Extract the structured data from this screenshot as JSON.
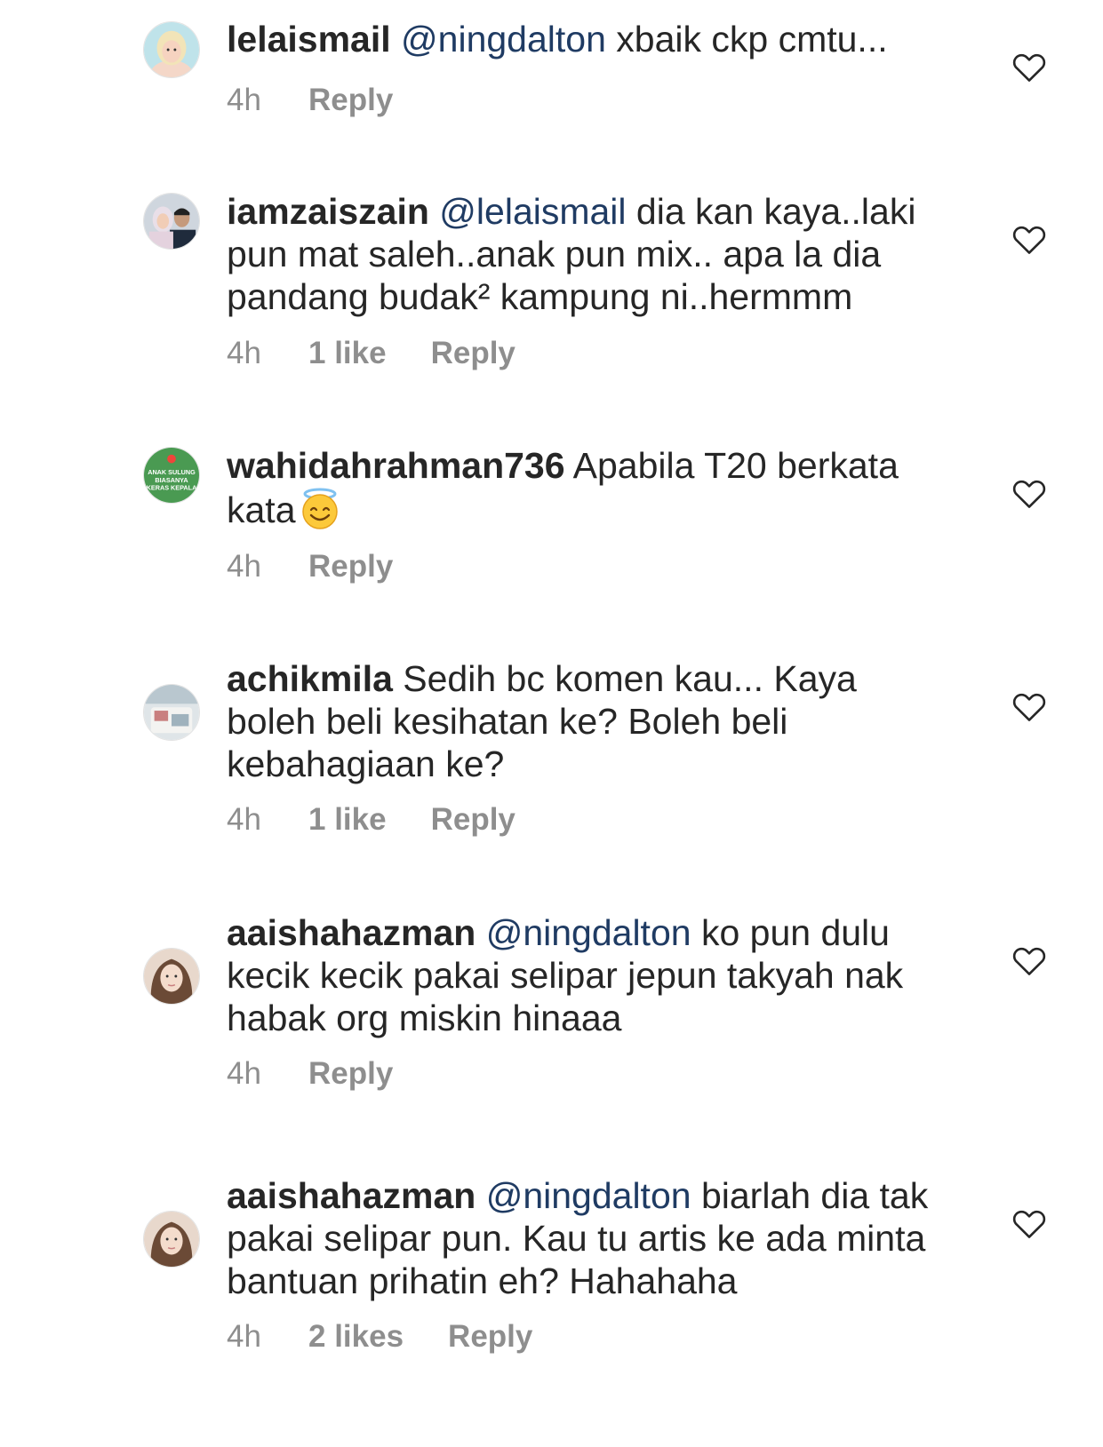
{
  "comments": [
    {
      "username": "lelaismail",
      "mention": "@ningdalton",
      "text": " xbaik ckp cmtu...",
      "time": "4h",
      "likes": "",
      "reply": "Reply"
    },
    {
      "username": "iamzaiszain",
      "mention": "@lelaismail",
      "text": " dia kan kaya..laki pun mat saleh..anak pun mix.. apa la dia pandang budak² kampung ni..hermmm",
      "time": "4h",
      "likes": "1 like",
      "reply": "Reply"
    },
    {
      "username": "wahidahrahman736",
      "mention": "",
      "text": " Apabila T20 berkata kata",
      "time": "4h",
      "likes": "",
      "reply": "Reply",
      "avatar_text": [
        "ANAK SULUNG",
        "BIASANYA",
        "KERAS KEPALA"
      ]
    },
    {
      "username": "achikmila",
      "mention": "",
      "text": " Sedih bc komen kau... Kaya boleh beli kesihatan ke? Boleh beli kebahagiaan ke?",
      "time": "4h",
      "likes": "1 like",
      "reply": "Reply"
    },
    {
      "username": "aaishahazman",
      "mention": "@ningdalton",
      "text": " ko pun dulu kecik kecik pakai selipar jepun takyah nak habak org miskin hinaaa",
      "time": "4h",
      "likes": "",
      "reply": "Reply"
    },
    {
      "username": "aaishahazman",
      "mention": "@ningdalton",
      "text": " biarlah dia tak pakai selipar pun. Kau tu artis ke ada minta bantuan prihatin eh? Hahahaha",
      "time": "4h",
      "likes": "2 likes",
      "reply": "Reply"
    }
  ],
  "colors": {
    "username": "#262626",
    "mention": "#1f3b63",
    "meta": "#8e8e8e",
    "heart": "#262626"
  },
  "icons": {
    "like": "heart-outline-icon",
    "emoji": "smiling-face-with-halo"
  }
}
